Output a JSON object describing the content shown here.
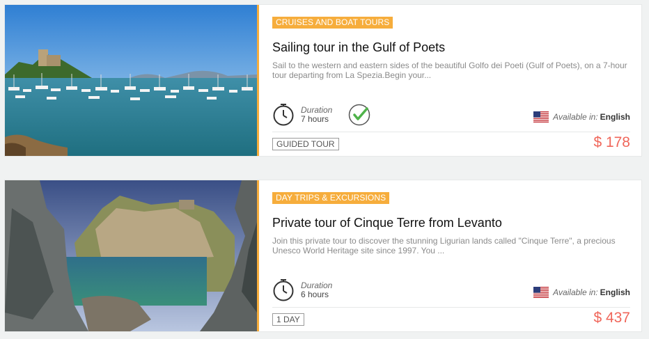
{
  "tours": [
    {
      "category": "CRUISES AND BOAT TOURS",
      "title": "Sailing tour in the Gulf of Poets",
      "description": "Sail to the western and eastern sides of the beautiful Golfo dei Poeti (Gulf of Poets), on a 7-hour tour departing from La Spezia.Begin your...",
      "duration_label": "Duration",
      "duration_value": "7 hours",
      "available_label": "Available in:",
      "available_language": "English",
      "tag": "GUIDED TOUR",
      "price": "$ 178"
    },
    {
      "category": "DAY TRIPS & EXCURSIONS",
      "title": "Private tour of Cinque Terre from Levanto",
      "description": "Join this private tour to discover the stunning Ligurian lands called \"Cinque Terre\", a precious Unesco World Heritage site since 1997. You ...",
      "duration_label": "Duration",
      "duration_value": "6 hours",
      "available_label": "Available in:",
      "available_language": "English",
      "tag": "1 DAY",
      "price": "$ 437"
    }
  ],
  "colors": {
    "accent": "#f6ad3c",
    "price": "#f0665a",
    "check": "#4fb34a",
    "background": "#f0f2f2"
  },
  "icons": {
    "duration": "clock-icon",
    "confirmed": "checkmark-circle-icon",
    "language": "us-flag-icon"
  }
}
